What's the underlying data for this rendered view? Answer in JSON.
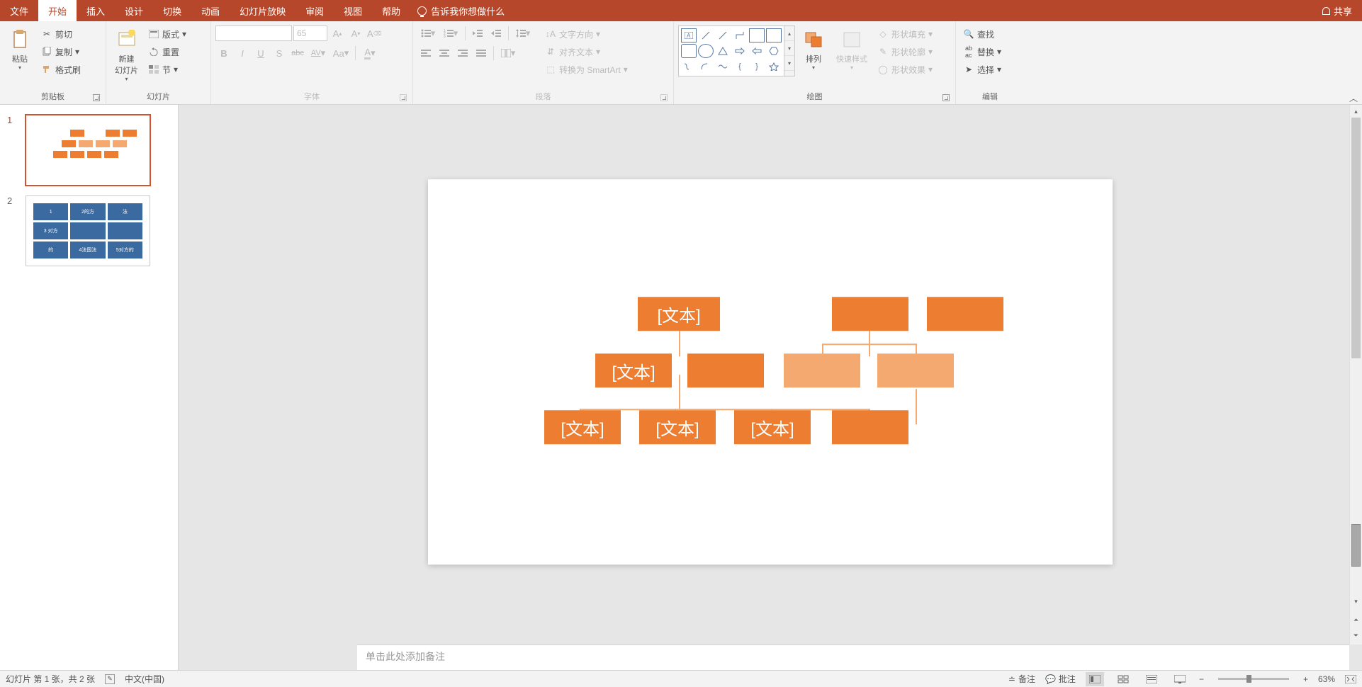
{
  "menubar": {
    "tabs": [
      "文件",
      "开始",
      "插入",
      "设计",
      "切换",
      "动画",
      "幻灯片放映",
      "审阅",
      "视图",
      "帮助"
    ],
    "active_index": 1,
    "tell_me": "告诉我你想做什么",
    "share": "共享"
  },
  "ribbon": {
    "clipboard": {
      "label": "剪贴板",
      "paste": "粘贴",
      "cut": "剪切",
      "copy": "复制",
      "format_painter": "格式刷"
    },
    "slides": {
      "label": "幻灯片",
      "new_slide": "新建\n幻灯片",
      "layout": "版式",
      "reset": "重置",
      "section": "节"
    },
    "font": {
      "label": "字体",
      "size_value": "65",
      "bold": "B",
      "italic": "I",
      "underline": "U",
      "shadow": "S",
      "strike": "abc",
      "spacing": "AV",
      "case": "Aa",
      "color": "A"
    },
    "paragraph": {
      "label": "段落",
      "text_direction": "文字方向",
      "align_text": "对齐文本",
      "convert_smartart": "转换为 SmartArt"
    },
    "drawing": {
      "label": "绘图",
      "arrange": "排列",
      "quick_styles": "快速样式",
      "shape_fill": "形状填充",
      "shape_outline": "形状轮廓",
      "shape_effects": "形状效果"
    },
    "editing": {
      "label": "编辑",
      "find": "查找",
      "replace": "替换",
      "select": "选择"
    }
  },
  "thumbnails": {
    "items": [
      {
        "num": "1",
        "selected": true
      },
      {
        "num": "2",
        "selected": false
      }
    ],
    "slide2_cells": [
      "1",
      "2的方",
      "法",
      "3 对方",
      "",
      "",
      "的",
      "4法国法",
      "5对方的"
    ]
  },
  "slide_content": {
    "placeholder": "[文本]"
  },
  "notes": {
    "placeholder": "单击此处添加备注"
  },
  "statusbar": {
    "slide_info": "幻灯片 第 1 张，共 2 张",
    "language": "中文(中国)",
    "notes_btn": "备注",
    "comments_btn": "批注",
    "zoom": "63%"
  }
}
